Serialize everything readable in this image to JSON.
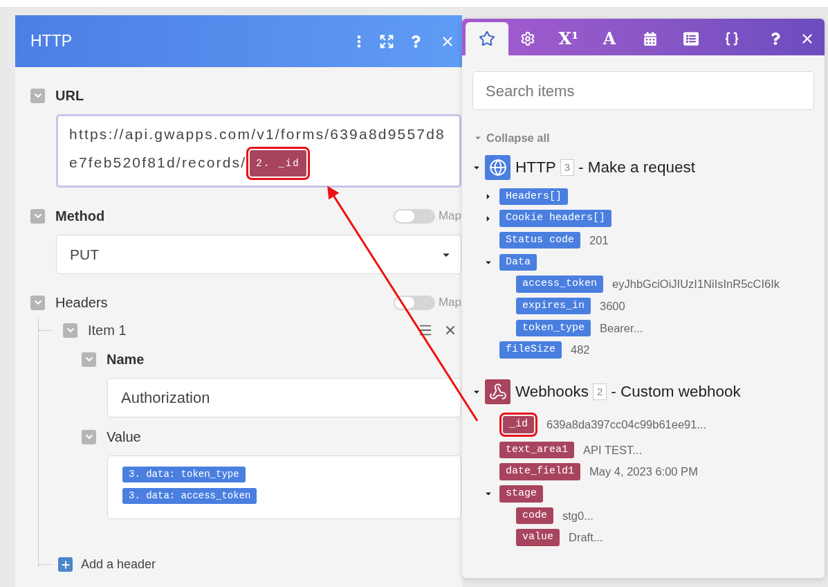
{
  "module": {
    "title": "HTTP",
    "fields": [
      {
        "kind": "text",
        "label": "URL",
        "required": true,
        "expanded": true,
        "text": "https://api.gwapps.com/v1/forms/639a8d9557d8e7feb520f81d/records/",
        "tokens": [
          {
            "text": "2. _id",
            "color": "#a8445e",
            "highlighted": true
          }
        ]
      },
      {
        "kind": "select",
        "label": "Method",
        "required": true,
        "expanded": true,
        "map": {
          "label": "Map",
          "on": false
        },
        "value": "PUT"
      },
      {
        "kind": "list",
        "label": "Headers",
        "required": false,
        "expanded": true,
        "map": {
          "label": "Map",
          "on": false
        },
        "items": [
          {
            "title": "Item 1",
            "expanded": true,
            "fields": [
              {
                "kind": "input",
                "label": "Name",
                "required": true,
                "expanded": true,
                "value": "Authorization"
              },
              {
                "kind": "tokens",
                "label": "Value",
                "required": false,
                "expanded": true,
                "tokens": [
                  {
                    "text": "3. data: token_type",
                    "color": "#4a7fe0",
                    "highlighted": false
                  },
                  {
                    "text": "3. data: access_token",
                    "color": "#4a7fe0",
                    "highlighted": false
                  }
                ]
              }
            ]
          }
        ],
        "add_label": "Add a header"
      }
    ]
  },
  "mapper": {
    "tabs": [
      {
        "selected": true
      },
      {
        "selected": false
      },
      {
        "label": "X¹",
        "selected": false
      },
      {
        "label": "A",
        "selected": false
      },
      {
        "selected": false
      },
      {
        "selected": false
      },
      {
        "selected": false
      }
    ],
    "search": {
      "placeholder": "Search items"
    },
    "collapse_label": "Collapse all",
    "groups": [
      {
        "kind": "http",
        "name": "HTTP",
        "count": "3",
        "subtitle": "- Make a request",
        "color": "#4a7fe0",
        "items": [
          {
            "label": "Headers[]",
            "expanded": false
          },
          {
            "label": "Cookie headers[]",
            "expanded": false
          },
          {
            "label": "Status code",
            "value": "201"
          },
          {
            "label": "Data",
            "expanded": true,
            "children": [
              {
                "label": "access_token",
                "value": "eyJhbGciOiJIUzI1NiIsInR5cCI6Ik"
              },
              {
                "label": "expires_in",
                "value": "3600"
              },
              {
                "label": "token_type",
                "value": "Bearer..."
              }
            ]
          },
          {
            "label": "fileSize",
            "value": "482"
          }
        ]
      },
      {
        "kind": "webhook",
        "name": "Webhooks",
        "count": "2",
        "subtitle": "- Custom webhook",
        "color": "#a8445e",
        "items": [
          {
            "label": "_id",
            "value": "639a8da397cc04c99b61ee91...",
            "highlighted": true
          },
          {
            "label": "text_area1",
            "value": "API TEST..."
          },
          {
            "label": "date_field1",
            "value": "May 4, 2023 6:00 PM"
          },
          {
            "label": "stage",
            "expanded": true,
            "children": [
              {
                "label": "code",
                "value": "stg0..."
              },
              {
                "label": "value",
                "value": "Draft..."
              }
            ]
          }
        ]
      }
    ]
  }
}
